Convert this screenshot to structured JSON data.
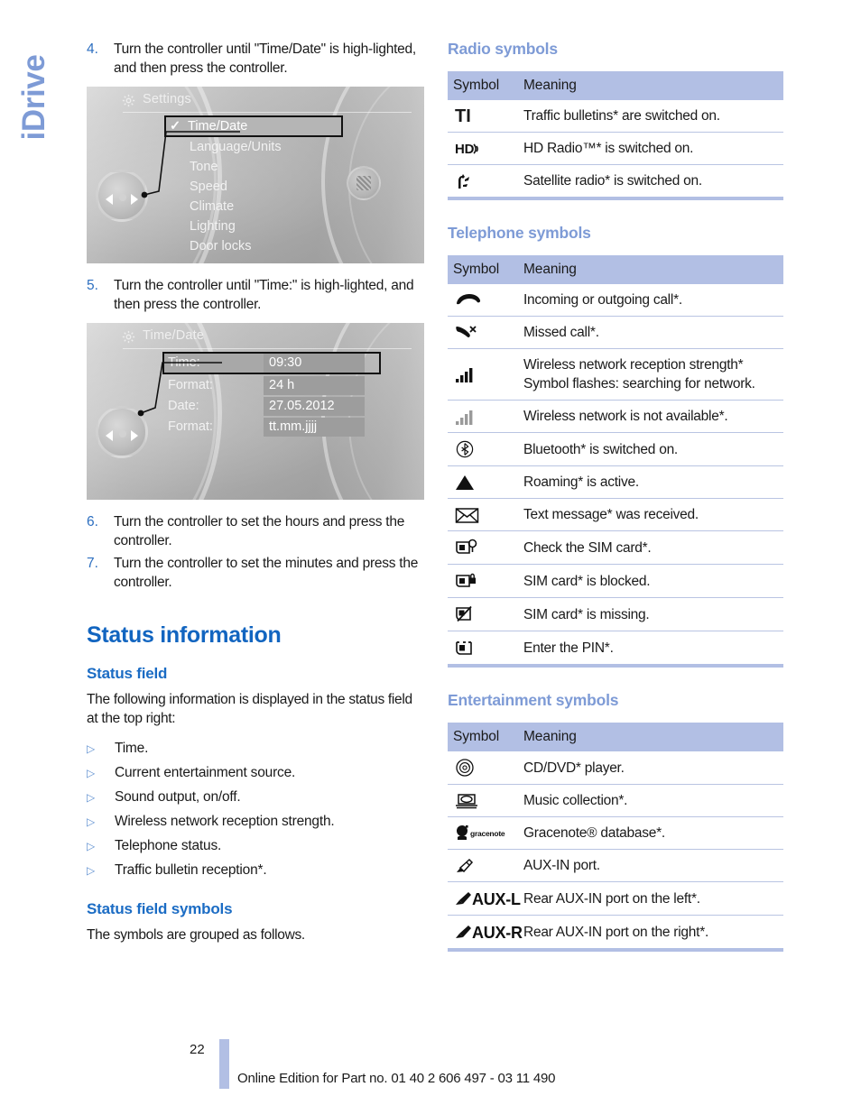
{
  "chapter_tab": {
    "label": "iDrive"
  },
  "left_column": {
    "steps_top": [
      {
        "num": "4.",
        "text": "Turn the controller until \"Time/Date\" is high-lighted, and then press the controller."
      },
      {
        "num": "5.",
        "text": "Turn the controller until \"Time:\" is high-lighted, and then press the controller."
      }
    ],
    "steps_bottom": [
      {
        "num": "6.",
        "text": "Turn the controller to set the hours and press the controller."
      },
      {
        "num": "7.",
        "text": "Turn the controller to set the minutes and press the controller."
      }
    ],
    "screenshot_settings": {
      "title": "Settings",
      "gear_icon": "gear-icon",
      "items": [
        {
          "label": "Time/Date",
          "selected": true,
          "check": "✓"
        },
        {
          "label": "Language/Units",
          "selected": false
        },
        {
          "label": "Tone",
          "selected": false
        },
        {
          "label": "Speed",
          "selected": false
        },
        {
          "label": "Climate",
          "selected": false
        },
        {
          "label": "Lighting",
          "selected": false
        },
        {
          "label": "Door locks",
          "selected": false
        }
      ]
    },
    "screenshot_timedate": {
      "title": "Time/Date",
      "gear_icon": "gear-icon",
      "rows": [
        {
          "label": "Time:",
          "value": "09:30",
          "selected": true
        },
        {
          "label": "Format:",
          "value": "24 h",
          "selected": false
        },
        {
          "label": "Date:",
          "value": "27.05.2012",
          "selected": false
        },
        {
          "label": "Format:",
          "value": "tt.mm.jjjj",
          "selected": false
        }
      ]
    },
    "section_title": "Status information",
    "status_field": {
      "heading": "Status field",
      "intro": "The following information is displayed in the status field at the top right:",
      "bullets": [
        "Time.",
        "Current entertainment source.",
        "Sound output, on/off.",
        "Wireless network reception strength.",
        "Telephone status.",
        "Traffic bulletin reception*."
      ]
    },
    "status_field_symbols": {
      "heading": "Status field symbols",
      "text": "The symbols are grouped as follows."
    }
  },
  "right_column": {
    "radio": {
      "title": "Radio symbols",
      "headers": {
        "symbol": "Symbol",
        "meaning": "Meaning"
      },
      "rows": [
        {
          "icon": "traffic-bulletin-ti-icon",
          "glyph": "TI",
          "meaning": "Traffic bulletins* are switched on."
        },
        {
          "icon": "hd-radio-icon",
          "glyph": "HD",
          "meaning": "HD Radio™* is switched on."
        },
        {
          "icon": "satellite-radio-icon",
          "glyph": "",
          "meaning": "Satellite radio* is switched on."
        }
      ]
    },
    "telephone": {
      "title": "Telephone symbols",
      "headers": {
        "symbol": "Symbol",
        "meaning": "Meaning"
      },
      "rows": [
        {
          "icon": "handset-call-icon",
          "meaning": "Incoming or outgoing call*."
        },
        {
          "icon": "missed-call-icon",
          "meaning": "Missed call*."
        },
        {
          "icon": "signal-bars-icon",
          "meaning": "Wireless network reception strength* Symbol flashes: searching for network."
        },
        {
          "icon": "signal-bars-grey-icon",
          "meaning": "Wireless network is not available*."
        },
        {
          "icon": "bluetooth-icon",
          "meaning": "Bluetooth* is switched on."
        },
        {
          "icon": "roaming-triangle-icon",
          "meaning": "Roaming* is active."
        },
        {
          "icon": "envelope-icon",
          "meaning": "Text message* was received."
        },
        {
          "icon": "sim-check-icon",
          "meaning": "Check the SIM card*."
        },
        {
          "icon": "sim-blocked-icon",
          "meaning": "SIM card* is blocked."
        },
        {
          "icon": "sim-missing-icon",
          "meaning": "SIM card* is missing."
        },
        {
          "icon": "sim-pin-icon",
          "meaning": "Enter the PIN*."
        }
      ]
    },
    "entertainment": {
      "title": "Entertainment symbols",
      "headers": {
        "symbol": "Symbol",
        "meaning": "Meaning"
      },
      "rows": [
        {
          "icon": "cd-dvd-icon",
          "glyph": "",
          "meaning": "CD/DVD* player."
        },
        {
          "icon": "music-collection-icon",
          "glyph": "",
          "meaning": "Music collection*."
        },
        {
          "icon": "gracenote-icon",
          "glyph": "gracenote",
          "meaning": "Gracenote® database*."
        },
        {
          "icon": "aux-in-plug-icon",
          "glyph": "",
          "meaning": "AUX-IN port."
        },
        {
          "icon": "aux-left-icon",
          "glyph": "AUX-L",
          "meaning": "Rear AUX-IN port on the left*."
        },
        {
          "icon": "aux-right-icon",
          "glyph": "AUX-R",
          "meaning": "Rear AUX-IN port on the right*."
        }
      ]
    }
  },
  "footer": {
    "page_number": "22",
    "text": "Online Edition for Part no. 01 40 2 606 497 - 03 11 490"
  },
  "colors": {
    "heading_blue": "#1265c0",
    "sub_heading_blue": "#1b6cc4",
    "table_header_blue": "#b2bfe4",
    "tab_blue": "#7e9bd6",
    "rule_blue": "#b9c4e2"
  }
}
